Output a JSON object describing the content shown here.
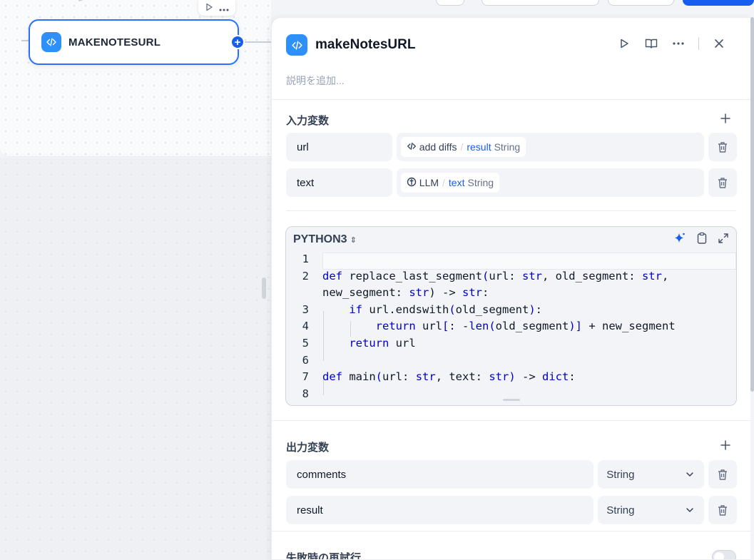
{
  "node": {
    "title": "MAKENOTESURL"
  },
  "panel": {
    "title": "makeNotesURL",
    "description_placeholder": "説明を追加..."
  },
  "inputs": {
    "section_title": "入力変数",
    "items": [
      {
        "name": "url",
        "source_node": "add diffs",
        "source_var": "result",
        "type": "String",
        "source_icon": "code-icon"
      },
      {
        "name": "text",
        "source_node": "LLM",
        "source_var": "text",
        "type": "String",
        "source_icon": "llm-icon"
      }
    ]
  },
  "code": {
    "language": "PYTHON3",
    "lines": [
      {
        "num": "1",
        "html": ""
      },
      {
        "num": "2",
        "html": "<span class=\"k\">def</span> replace_last_segment<span class=\"t\">(</span>url: <span class=\"t\">str</span>, old_segment: <span class=\"t\">str</span>,"
      },
      {
        "num": "",
        "html": "new_segment: <span class=\"t\">str</span>) -> <span class=\"t\">str</span>:"
      },
      {
        "num": "3",
        "html": "    <span class=\"k\">if</span> url.endswith<span class=\"t\">(</span>old_segment<span class=\"t\">)</span>:"
      },
      {
        "num": "4",
        "html": "        <span class=\"k\">return</span> url<span class=\"t\">[</span>: -<span class=\"t\">len</span><span class=\"t\">(</span>old_segment<span class=\"t\">)</span><span class=\"t\">]</span> + new_segment"
      },
      {
        "num": "5",
        "html": "    <span class=\"k\">return</span> url"
      },
      {
        "num": "6",
        "html": ""
      },
      {
        "num": "7",
        "html": "<span class=\"k\">def</span> main<span class=\"t\">(</span>url: <span class=\"t\">str</span>, text: <span class=\"t\">str</span><span class=\"t\">)</span> -> <span class=\"t\">dict</span>:"
      },
      {
        "num": "8",
        "html": ""
      }
    ]
  },
  "outputs": {
    "section_title": "出力変数",
    "items": [
      {
        "name": "comments",
        "type": "String"
      },
      {
        "name": "result",
        "type": "String"
      }
    ]
  },
  "retry": {
    "label": "失敗時の再試行"
  }
}
